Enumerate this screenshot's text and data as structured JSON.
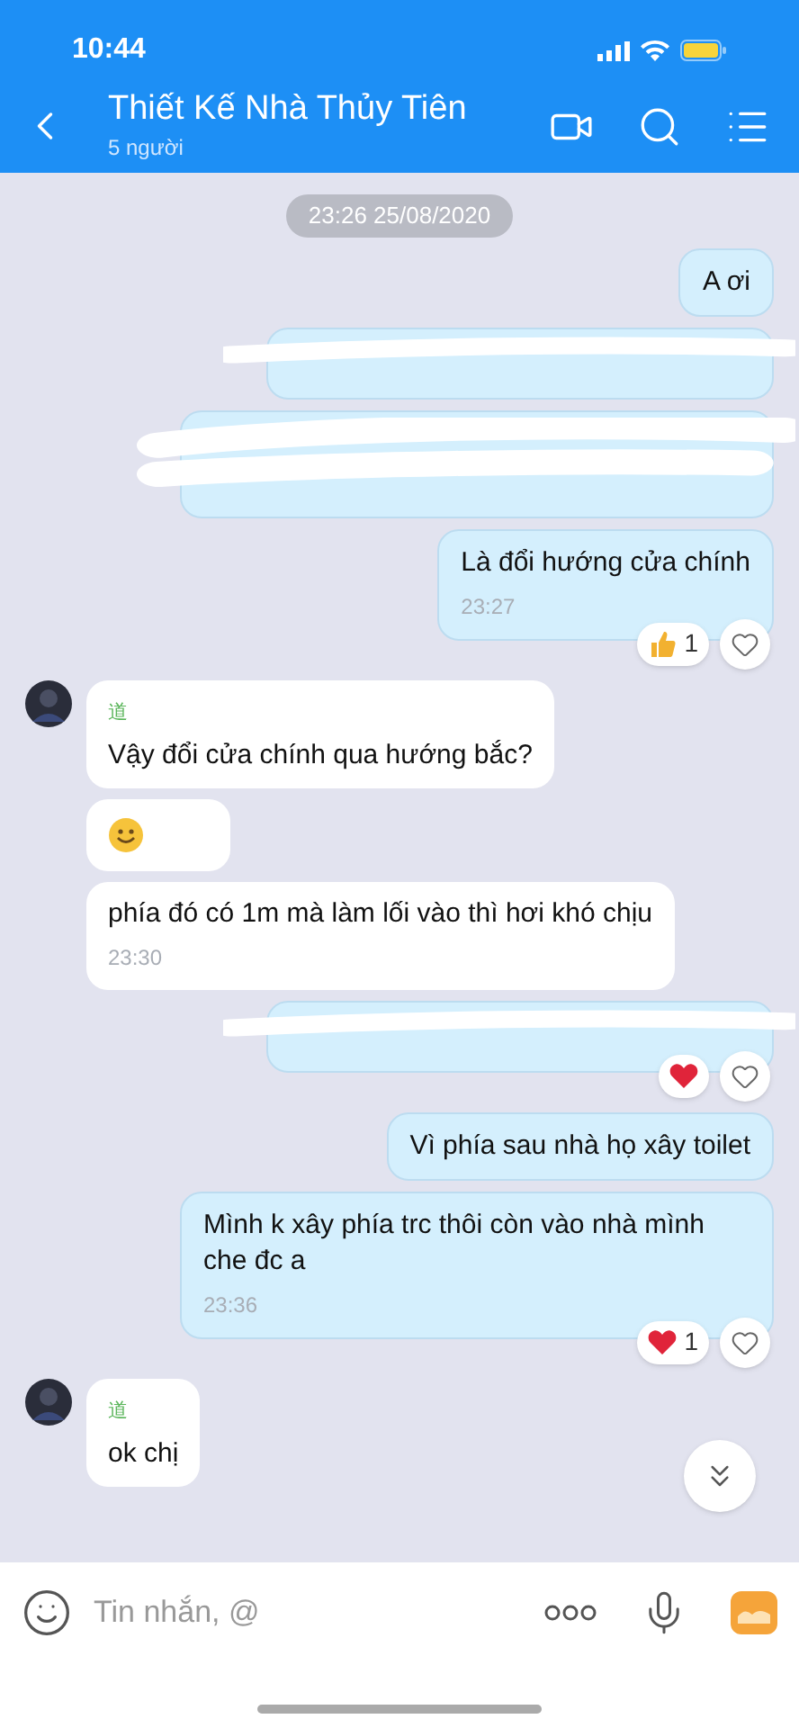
{
  "status_bar": {
    "time": "10:44"
  },
  "header": {
    "title": "Thiết Kế Nhà Thủy Tiên",
    "subtitle": "5 người"
  },
  "date_divider": "23:26 25/08/2020",
  "messages": [
    {
      "kind": "sent_text",
      "text": "A ơi"
    },
    {
      "kind": "sent_redacted"
    },
    {
      "kind": "sent_redacted_tall"
    },
    {
      "kind": "sent_text",
      "text": "Là đổi hướng cửa chính",
      "time": "23:27",
      "reaction": {
        "kind": "like",
        "count": "1"
      }
    },
    {
      "kind": "received_text",
      "sender": "道",
      "text": "Vậy đổi cửa chính qua hướng bắc?"
    },
    {
      "kind": "received_sticker"
    },
    {
      "kind": "received_text",
      "text": "phía đó có 1m mà làm lối vào thì hơi khó chịu",
      "time": "23:30"
    },
    {
      "kind": "sent_redacted",
      "reaction": {
        "kind": "heart"
      }
    },
    {
      "kind": "sent_text",
      "text": "Vì phía sau nhà họ xây toilet"
    },
    {
      "kind": "sent_text",
      "text": "Mình k xây phía trc thôi còn vào nhà mình che đc a",
      "time": "23:36",
      "reaction": {
        "kind": "heart",
        "count": "1"
      }
    },
    {
      "kind": "received_text",
      "sender": "道",
      "text": "ok chị"
    }
  ],
  "composer": {
    "placeholder": "Tin nhắn, @"
  }
}
